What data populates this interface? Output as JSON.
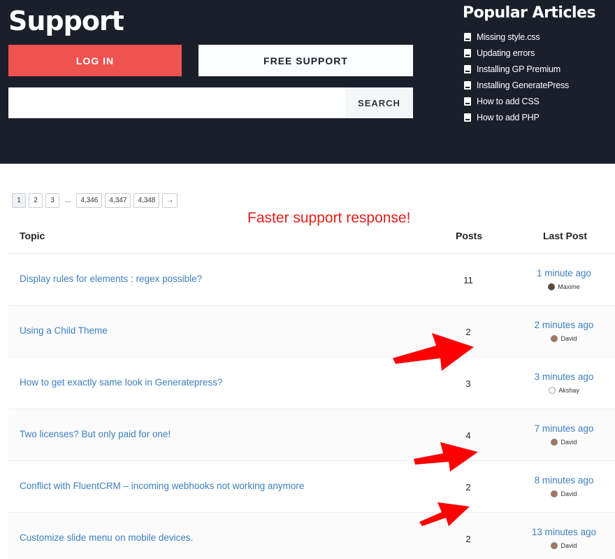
{
  "header": {
    "title": "Support",
    "login_label": "LOG IN",
    "free_support_label": "FREE SUPPORT",
    "search_placeholder": "",
    "search_label": "SEARCH"
  },
  "popular": {
    "title": "Popular Articles",
    "items": [
      "Missing style.css",
      "Updating errors",
      "Installing GP Premium",
      "Installing GeneratePress",
      "How to add CSS",
      "How to add PHP"
    ]
  },
  "pagination": {
    "pages": [
      "1",
      "2",
      "3"
    ],
    "ellipsis": "...",
    "last_pages": [
      "4,346",
      "4,347",
      "4,348"
    ],
    "next": "→"
  },
  "promo_text": "Faster support response!",
  "table": {
    "headers": {
      "topic": "Topic",
      "posts": "Posts",
      "last_post": "Last Post"
    },
    "rows": [
      {
        "topic": "Display rules for elements : regex possible?",
        "posts": "11",
        "time": "1 minute ago",
        "user": "Maxime"
      },
      {
        "topic": "Using a Child Theme",
        "posts": "2",
        "time": "2 minutes ago",
        "user": "David"
      },
      {
        "topic": "How to get exactly same look in Generatepress?",
        "posts": "3",
        "time": "3 minutes ago",
        "user": "Akshay"
      },
      {
        "topic": "Two licenses? But only paid for one!",
        "posts": "4",
        "time": "7 minutes ago",
        "user": "David"
      },
      {
        "topic": "Conflict with FluentCRM – incoming webhooks not working anymore",
        "posts": "2",
        "time": "8 minutes ago",
        "user": "David"
      },
      {
        "topic": "Customize slide menu on mobile devices.",
        "posts": "2",
        "time": "13 minutes ago",
        "user": "David"
      }
    ]
  },
  "colors": {
    "header_bg": "#1b1f2a",
    "login_bg": "#ef5350",
    "link": "#3c7fbf",
    "promo": "#e0201b",
    "arrow": "#ff0000"
  }
}
